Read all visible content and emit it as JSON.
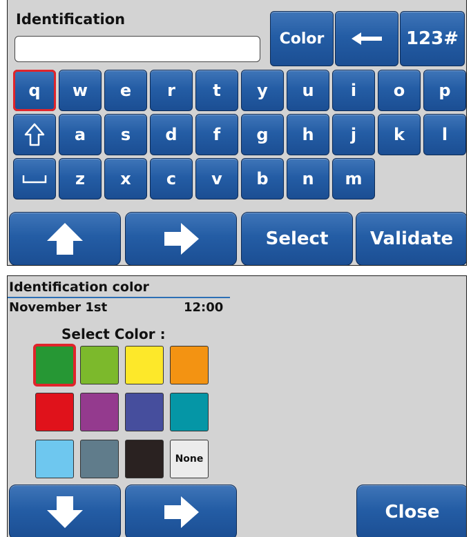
{
  "keyboard_panel": {
    "title": "Identification",
    "input_value": "",
    "buttons": {
      "color": "Color",
      "backspace_icon": "left-arrow-icon",
      "numeric": "123#"
    },
    "rows": [
      [
        "q",
        "w",
        "e",
        "r",
        "t",
        "y",
        "u",
        "i",
        "o",
        "p"
      ],
      [
        "a",
        "s",
        "d",
        "f",
        "g",
        "h",
        "j",
        "k",
        "l"
      ],
      [
        "z",
        "x",
        "c",
        "v",
        "b",
        "n",
        "m"
      ]
    ],
    "selected_key": "q",
    "shift_icon": "shift-arrow-icon",
    "space_icon": "space-bar-icon",
    "bottom_bar": {
      "up_icon": "up-arrow-icon",
      "right_icon": "right-arrow-icon",
      "select": "Select",
      "validate": "Validate"
    }
  },
  "color_panel": {
    "title": "Identification color",
    "date": "November 1st",
    "time": "12:00",
    "prompt": "Select Color :",
    "swatches": [
      {
        "color": "#269734",
        "selected": true
      },
      {
        "color": "#7cb92c"
      },
      {
        "color": "#fde82a"
      },
      {
        "color": "#f39312"
      },
      {
        "color": "#e0121b"
      },
      {
        "color": "#943a8e"
      },
      {
        "color": "#464e9d"
      },
      {
        "color": "#0596a6"
      },
      {
        "color": "#6ec7ef"
      },
      {
        "color": "#607c8b"
      },
      {
        "color": "#2a2221"
      },
      {
        "label": "None"
      }
    ],
    "bottom_bar": {
      "down_icon": "down-arrow-icon",
      "right_icon": "right-arrow-icon",
      "close": "Close"
    }
  }
}
